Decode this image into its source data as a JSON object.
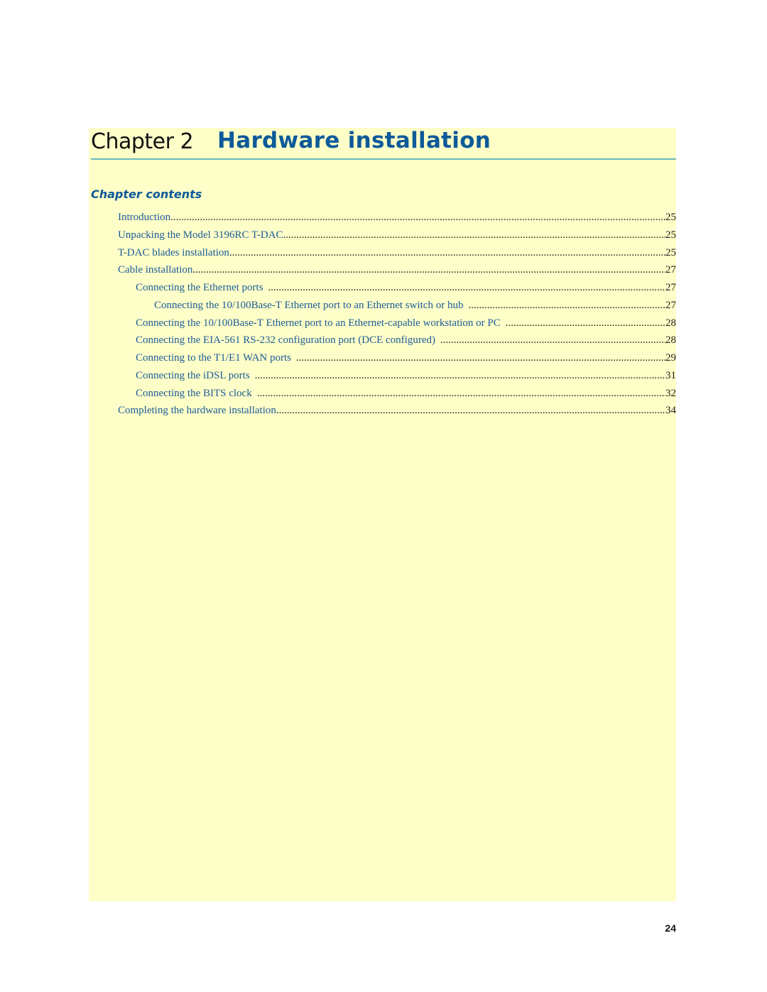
{
  "chapter": {
    "label": "Chapter 2",
    "title": "Hardware installation"
  },
  "contents": {
    "heading": "Chapter contents",
    "entries": [
      {
        "text": "Introduction",
        "page": "25",
        "level": 1
      },
      {
        "text": "Unpacking the Model 3196RC T-DAC",
        "page": "25",
        "level": 1
      },
      {
        "text": "T-DAC blades installation",
        "page": "25",
        "level": 1
      },
      {
        "text": "Cable installation",
        "page": "27",
        "level": 1
      },
      {
        "text": "Connecting the Ethernet ports",
        "page": "27",
        "level": 2
      },
      {
        "text": "Connecting the 10/100Base-T Ethernet port to an Ethernet switch or hub",
        "page": "27",
        "level": 3
      },
      {
        "text": "Connecting the 10/100Base-T Ethernet port to an Ethernet-capable workstation or PC",
        "page": "28",
        "level": 2
      },
      {
        "text": "Connecting the EIA-561 RS-232 configuration port (DCE configured)",
        "page": "28",
        "level": 2
      },
      {
        "text": "Connecting to the T1/E1 WAN ports",
        "page": "29",
        "level": 2
      },
      {
        "text": "Connecting the iDSL ports",
        "page": "31",
        "level": 2
      },
      {
        "text": "Connecting the BITS clock",
        "page": "32",
        "level": 2
      },
      {
        "text": "Completing the hardware installation",
        "page": "34",
        "level": 1
      }
    ]
  },
  "footer": {
    "page_number": "24"
  }
}
